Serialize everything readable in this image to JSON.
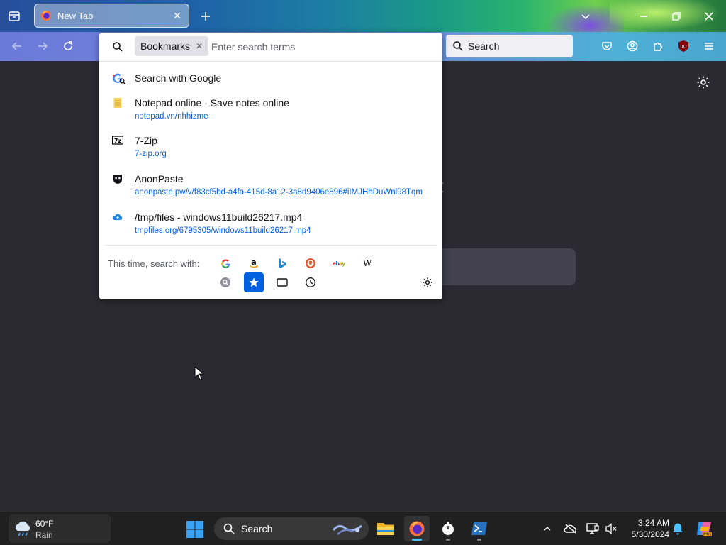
{
  "browser": {
    "tab": {
      "title": "New Tab"
    },
    "search_bar": {
      "placeholder": "Search"
    }
  },
  "urlbar_popup": {
    "chip_label": "Bookmarks",
    "input_placeholder": "Enter search terms",
    "results": [
      {
        "title": "Search with Google",
        "url": "",
        "icon": "google-icon"
      },
      {
        "title": "Notepad online - Save notes online",
        "url": "notepad.vn/nhhizme",
        "icon": "notepad-icon"
      },
      {
        "title": "7-Zip",
        "url": "7-zip.org",
        "icon": "7zip-icon"
      },
      {
        "title": "AnonPaste",
        "url": "anonpaste.pw/v/f83cf5bd-a4fa-415d-8a12-3a8d9406e896#iIMJHhDuWnl98Tqm",
        "icon": "anonpaste-icon"
      },
      {
        "title": "/tmp/files - windows11build26217.mp4",
        "url": "tmpfiles.org/6795305/windows11build26217.mp4",
        "icon": "tmpfiles-cloud-icon"
      }
    ],
    "oneoff_label": "This time, search with:",
    "oneoff_engines": [
      "google",
      "amazon",
      "bing",
      "duckduckgo",
      "ebay",
      "wikipedia"
    ],
    "oneoff_modes": [
      "search",
      "bookmarks",
      "tabs",
      "history"
    ],
    "selected_mode": "bookmarks"
  },
  "taskbar": {
    "weather": {
      "temp": "60°F",
      "condition": "Rain"
    },
    "search_label": "Search",
    "time": "3:24 AM",
    "date": "5/30/2024"
  },
  "colors": {
    "accent": "#0061e0",
    "page_bg": "#2b2a33",
    "taskbar_bg": "#202020"
  }
}
